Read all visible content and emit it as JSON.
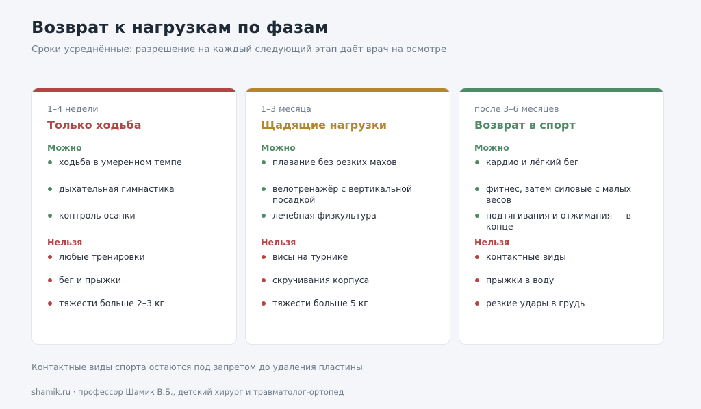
{
  "header": {
    "title": "Возврат к нагрузкам по фазам",
    "subtitle": "Сроки усреднённые: разрешение на каждый следующий этап даёт врач на осмотре"
  },
  "colors": {
    "phase1": "#b34545",
    "phase2": "#b5862b",
    "phase3": "#4e8a66",
    "allowed": "#4e8a66",
    "banned": "#b34545"
  },
  "phases": [
    {
      "term": "1–4 недели",
      "heading": "Только ходьба",
      "allowed_label": "Можно",
      "allowed": [
        "ходьба в умеренном темпе",
        "дыхательная гимнастика",
        "контроль осанки"
      ],
      "banned_label": "Нельзя",
      "banned": [
        "любые тренировки",
        "бег и прыжки",
        "тяжести больше 2–3 кг"
      ]
    },
    {
      "term": "1–3 месяца",
      "heading": "Щадящие нагрузки",
      "allowed_label": "Можно",
      "allowed": [
        "плавание без резких махов",
        "велотренажёр с вертикальной посадкой",
        "лечебная физкультура"
      ],
      "banned_label": "Нельзя",
      "banned": [
        "висы на турнике",
        "скручивания корпуса",
        "тяжести больше 5 кг"
      ]
    },
    {
      "term": "после 3–6 месяцев",
      "heading": "Возврат в спорт",
      "allowed_label": "Можно",
      "allowed": [
        "кардио и лёгкий бег",
        "фитнес, затем силовые с малых весов",
        "подтягивания и отжимания — в конце"
      ],
      "banned_label": "Нельзя",
      "banned": [
        "контактные виды",
        "прыжки в воду",
        "резкие удары в грудь"
      ]
    }
  ],
  "note": "Контактные виды спорта остаются под запретом до удаления пластины",
  "footer": "shamik.ru · профессор Шамик В.Б., детский хирург и травматолог-ортопед"
}
